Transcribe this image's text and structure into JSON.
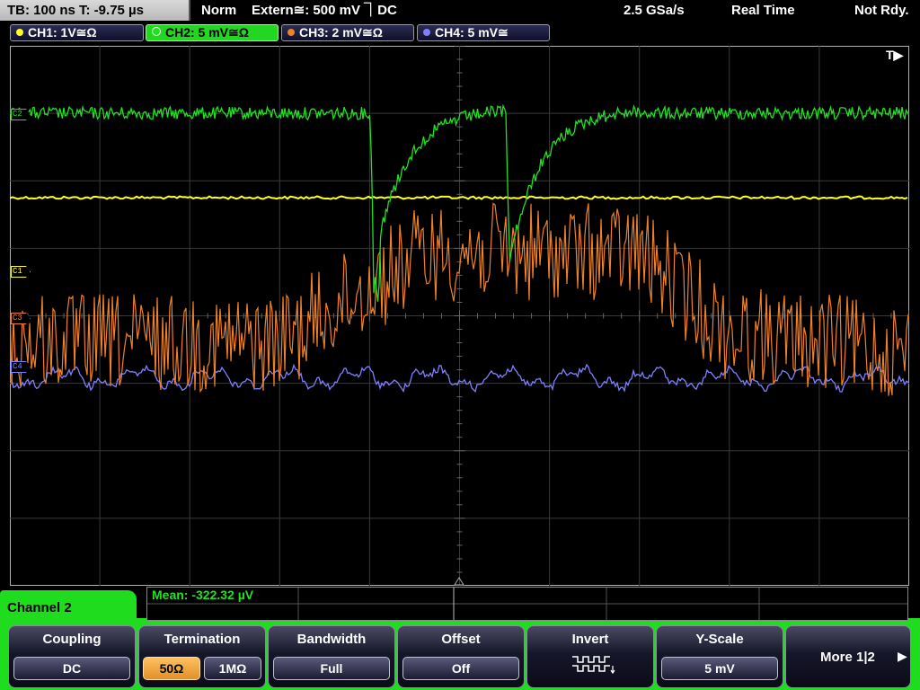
{
  "top": {
    "timebase": "TB: 100 ns   T: -9.75 µs",
    "trigger_mode": "Norm",
    "trigger_source": "Extern≅: 500 mV ⏋DC",
    "sample_rate": "2.5 GSa/s",
    "acq_mode": "Real Time",
    "status": "Not Rdy."
  },
  "channels": [
    {
      "label": "CH1: 1V≅Ω",
      "color": "#ffff20",
      "active": false
    },
    {
      "label": "CH2: 5 mV≅Ω",
      "color": "#22e022",
      "active": true
    },
    {
      "label": "CH3: 2 mV≅Ω",
      "color": "#f0802a",
      "active": false
    },
    {
      "label": "CH4: 5 mV≅",
      "color": "#8080ff",
      "active": false
    }
  ],
  "markers": {
    "c1": "C1",
    "c2": "C2",
    "c3": "C3",
    "c4": "C4"
  },
  "trigger_marker": "T▶",
  "measurement": "Mean: -322.32 µV",
  "menu": {
    "title": "Channel 2",
    "coupling": {
      "title": "Coupling",
      "value": "DC"
    },
    "termination": {
      "title": "Termination",
      "opt1": "50Ω",
      "opt2": "1MΩ"
    },
    "bandwidth": {
      "title": "Bandwidth",
      "value": "Full"
    },
    "offset": {
      "title": "Offset",
      "value": "Off"
    },
    "invert": {
      "title": "Invert"
    },
    "yscale": {
      "title": "Y-Scale",
      "value": "5 mV"
    },
    "more": "More 1|2"
  }
}
